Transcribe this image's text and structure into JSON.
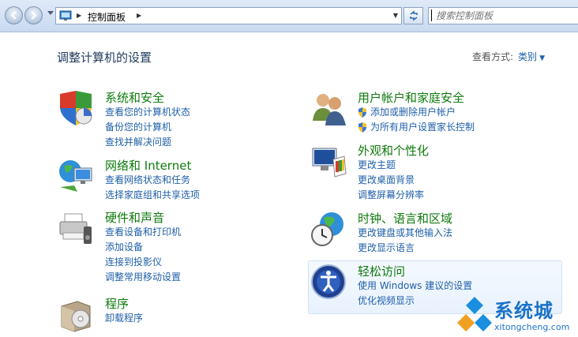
{
  "nav": {
    "breadcrumb": "控制面板",
    "search_placeholder": "搜索控制面板"
  },
  "header": {
    "title": "调整计算机的设置",
    "view_by_label": "查看方式:",
    "view_by_value": "类别"
  },
  "categories": {
    "system": {
      "title": "系统和安全",
      "links": [
        "查看您的计算机状态",
        "备份您的计算机",
        "查找并解决问题"
      ]
    },
    "network": {
      "title": "网络和 Internet",
      "links": [
        "查看网络状态和任务",
        "选择家庭组和共享选项"
      ]
    },
    "hardware": {
      "title": "硬件和声音",
      "links": [
        "查看设备和打印机",
        "添加设备",
        "连接到投影仪",
        "调整常用移动设置"
      ]
    },
    "programs": {
      "title": "程序",
      "links": [
        "卸载程序"
      ]
    },
    "users": {
      "title": "用户帐户和家庭安全",
      "links": [
        "添加或删除用户帐户",
        "为所有用户设置家长控制"
      ]
    },
    "appearance": {
      "title": "外观和个性化",
      "links": [
        "更改主题",
        "更改桌面背景",
        "调整屏幕分辨率"
      ]
    },
    "clock": {
      "title": "时钟、语言和区域",
      "links": [
        "更改键盘或其他输入法",
        "更改显示语言"
      ]
    },
    "ease": {
      "title": "轻松访问",
      "links": [
        "使用 Windows 建议的设置",
        "优化视频显示"
      ]
    }
  },
  "watermark": {
    "brand": "系统城",
    "url": "xitongcheng.com"
  },
  "colors": {
    "category_title": "#0e7a0d",
    "link": "#1f5fa8",
    "nav_bar": "#c9daf0"
  }
}
